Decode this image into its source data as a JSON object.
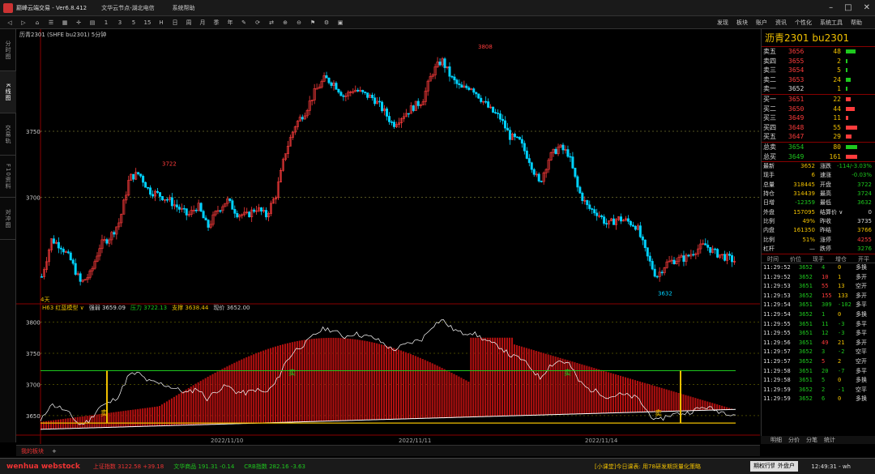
{
  "app": {
    "title": "巅峰云端交易 - Ver6.8.412",
    "menu": [
      "文华云节点-湖北电信",
      "系统帮助"
    ],
    "right_menu": [
      "发现",
      "板块",
      "账户",
      "资讯",
      "个性化",
      "系统工具",
      "帮助"
    ]
  },
  "toolbar": {
    "buttons": [
      "1",
      "3",
      "5",
      "15",
      "H",
      "日",
      "周",
      "月",
      "季",
      "年"
    ]
  },
  "sidebar": {
    "tabs": [
      "分时图",
      "K线图",
      "交易轨",
      "F10资料",
      "对冲图"
    ]
  },
  "chart": {
    "header": "历青2301 (SHFE bu2301) 5分钟",
    "peak_high": "3808",
    "peak_left": "3722",
    "low_right": "3632",
    "lbl_4days": "4天",
    "dates": [
      "2022/11/10",
      "2022/11/11",
      "2022/11/14"
    ],
    "yticks_main": [
      "3750",
      "3700"
    ],
    "yticks_ind": [
      "3800",
      "3750",
      "3700",
      "3650"
    ],
    "sell_marker": "卖"
  },
  "indicator": {
    "name": "H63 红蓝模型",
    "drop": "∨",
    "items": [
      {
        "label": "强弱",
        "value": "3659.09",
        "color": "#ddd"
      },
      {
        "label": "压力",
        "value": "3722.13",
        "color": "#1ec81e"
      },
      {
        "label": "支撑",
        "value": "3638.44",
        "color": "#f0c000"
      },
      {
        "label": "现价",
        "value": "3652.00",
        "color": "#ddd"
      }
    ]
  },
  "chart_data": {
    "type": "line",
    "title": "历青2301 (SHFE bu2301) 5分钟",
    "ylim": [
      3620,
      3815
    ],
    "series": [
      {
        "values": [
          3640,
          3668,
          3663,
          3652,
          3635,
          3642,
          3664,
          3670,
          3682,
          3715,
          3718,
          3705,
          3702,
          3698,
          3692,
          3686,
          3694,
          3677,
          3690,
          3698,
          3688,
          3686,
          3692,
          3686,
          3702,
          3735,
          3755,
          3765,
          3780,
          3790,
          3786,
          3776,
          3782,
          3778,
          3775,
          3766,
          3755,
          3762,
          3768,
          3773,
          3794,
          3804,
          3790,
          3782,
          3784,
          3775,
          3766,
          3760,
          3746,
          3742,
          3728,
          3710,
          3730,
          3738,
          3733,
          3705,
          3692,
          3688,
          3679,
          3684,
          3682,
          3678,
          3656,
          3640,
          3650,
          3653,
          3654,
          3660,
          3664,
          3658,
          3655,
          3652
        ]
      }
    ]
  },
  "orderbook": {
    "symbol": "沥青2301 bu2301",
    "asks": [
      {
        "label": "卖五",
        "price": "3656",
        "vol": "48"
      },
      {
        "label": "卖四",
        "price": "3655",
        "vol": "2"
      },
      {
        "label": "卖三",
        "price": "3654",
        "vol": "5"
      },
      {
        "label": "卖二",
        "price": "3653",
        "vol": "24"
      },
      {
        "label": "卖一",
        "price": "3652",
        "vol": "1"
      }
    ],
    "bids": [
      {
        "label": "买一",
        "price": "3651",
        "vol": "22"
      },
      {
        "label": "买二",
        "price": "3650",
        "vol": "44"
      },
      {
        "label": "买三",
        "price": "3649",
        "vol": "11"
      },
      {
        "label": "买四",
        "price": "3648",
        "vol": "55"
      },
      {
        "label": "买五",
        "price": "3647",
        "vol": "29"
      }
    ],
    "totals": [
      {
        "label": "总卖",
        "price": "3654",
        "vol": "80"
      },
      {
        "label": "总买",
        "price": "3649",
        "vol": "161"
      }
    ]
  },
  "stats": [
    [
      "最新",
      "3652"
    ],
    [
      "涨跌",
      "-114/-3.03%"
    ],
    [
      "现手",
      "6"
    ],
    [
      "速涨",
      "-0.03%"
    ],
    [
      "总量",
      "318445"
    ],
    [
      "开盘",
      "3722"
    ],
    [
      "持仓",
      "314439"
    ],
    [
      "最高",
      "3724"
    ],
    [
      "日增",
      "-12359"
    ],
    [
      "最低",
      "3632"
    ],
    [
      "外盘",
      "157095"
    ],
    [
      "结算价 ∨",
      "0"
    ],
    [
      "比例",
      "49%"
    ],
    [
      "昨收",
      "3735"
    ],
    [
      "内盘",
      "161350"
    ],
    [
      "昨结",
      "3766"
    ],
    [
      "比例",
      "51%"
    ],
    [
      "涨停",
      "4255"
    ],
    [
      "杠杆",
      "—"
    ],
    [
      "跌停",
      "3276"
    ]
  ],
  "ticks": {
    "headers": [
      "时间",
      "价位",
      "现手",
      "增仓",
      "开平"
    ],
    "rows": [
      [
        "11:29:52",
        "3652",
        "4",
        "0",
        "多换"
      ],
      [
        "11:29:52",
        "3652",
        "10",
        "1",
        "多开"
      ],
      [
        "11:29:53",
        "3651",
        "55",
        "13",
        "空开"
      ],
      [
        "11:29:53",
        "3652",
        "155",
        "133",
        "多开"
      ],
      [
        "11:29:54",
        "3651",
        "309",
        "-102",
        "多平"
      ],
      [
        "11:29:54",
        "3652",
        "1",
        "0",
        "多换"
      ],
      [
        "11:29:55",
        "3651",
        "11",
        "-3",
        "多平"
      ],
      [
        "11:29:55",
        "3651",
        "12",
        "-3",
        "多平"
      ],
      [
        "11:29:56",
        "3651",
        "49",
        "21",
        "多开"
      ],
      [
        "11:29:57",
        "3652",
        "3",
        "-2",
        "空平"
      ],
      [
        "11:29:57",
        "3652",
        "5",
        "2",
        "空开"
      ],
      [
        "11:29:58",
        "3651",
        "20",
        "-7",
        "多平"
      ],
      [
        "11:29:58",
        "3651",
        "5",
        "0",
        "多换"
      ],
      [
        "11:29:59",
        "3652",
        "2",
        "-1",
        "空平"
      ],
      [
        "11:29:59",
        "3652",
        "6",
        "0",
        "多换"
      ]
    ]
  },
  "rtabs": [
    "明细",
    "分价",
    "分笔",
    "统计"
  ],
  "bottom_tabs": {
    "tab": "我的板块",
    "add": "+"
  },
  "statusbar": {
    "logo": "wenhua webstock",
    "indices": [
      {
        "name": "上证指数",
        "val": "3122.58",
        "chg": "+39.18"
      },
      {
        "name": "文华商品",
        "val": "191.31",
        "chg": "-0.14"
      },
      {
        "name": "CRB指数",
        "val": "282.16",
        "chg": "-3.63"
      }
    ],
    "news": "[小课堂]今日课表: 用78研发期货量化策略",
    "btn1": "期权行情",
    "btn2": "外盘户",
    "time": "12:49:31 - wh"
  },
  "colors": {
    "up": "#ff3c3c",
    "down": "#00d2ff",
    "green": "#1ec81e",
    "yellow": "#f0c000"
  }
}
